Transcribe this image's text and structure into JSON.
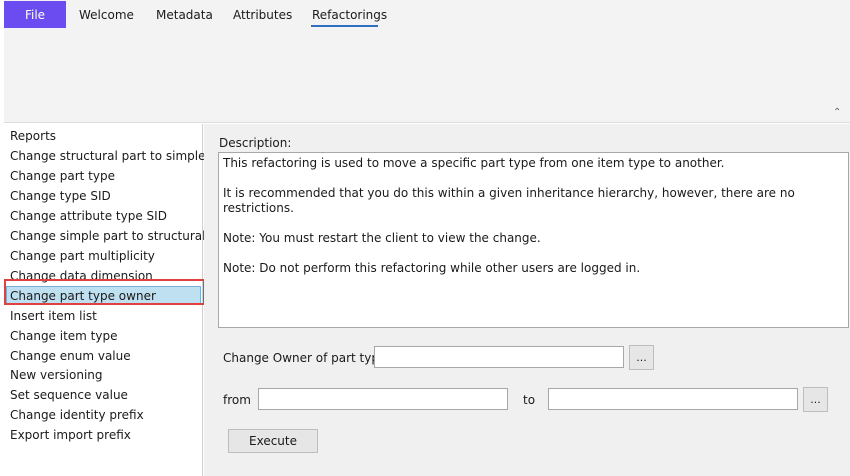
{
  "ribbon": {
    "file_label": "File",
    "tabs": [
      {
        "label": "Welcome"
      },
      {
        "label": "Metadata"
      },
      {
        "label": "Attributes"
      },
      {
        "label": "Refactorings"
      }
    ],
    "active_tab": "Refactorings"
  },
  "sidebar": {
    "items": [
      {
        "label": "Reports"
      },
      {
        "label": "Change structural part to simple"
      },
      {
        "label": "Change part type"
      },
      {
        "label": "Change type SID"
      },
      {
        "label": "Change attribute type SID"
      },
      {
        "label": "Change simple part to structural"
      },
      {
        "label": "Change part multiplicity"
      },
      {
        "label": "Change data dimension"
      },
      {
        "label": "Change part type owner"
      },
      {
        "label": "Insert item list"
      },
      {
        "label": "Change item type"
      },
      {
        "label": "Change enum value"
      },
      {
        "label": "New versioning"
      },
      {
        "label": "Set sequence value"
      },
      {
        "label": "Change identity prefix"
      },
      {
        "label": "Export import prefix"
      }
    ],
    "selected": "Change part type owner"
  },
  "main": {
    "description_label": "Description:",
    "description_lines": [
      "This refactoring is used to move a specific part type from one item type to another.",
      "It is recommended that you do this within a given inheritance hierarchy, however, there are no restrictions.",
      "Note: You must restart the client to view the change.",
      "Note: Do not perform this refactoring while other users are logged in."
    ],
    "owner_label": "Change Owner of part type:",
    "owner_value": "",
    "from_label": "from",
    "from_value": "",
    "to_label": "to",
    "to_value": "",
    "browse_label": "...",
    "execute_label": "Execute"
  },
  "colors": {
    "file_tab": "#6a4cf0",
    "active_underline": "#2f6fbf",
    "selected_bg": "#bfe0f0",
    "highlight": "#e04040"
  }
}
